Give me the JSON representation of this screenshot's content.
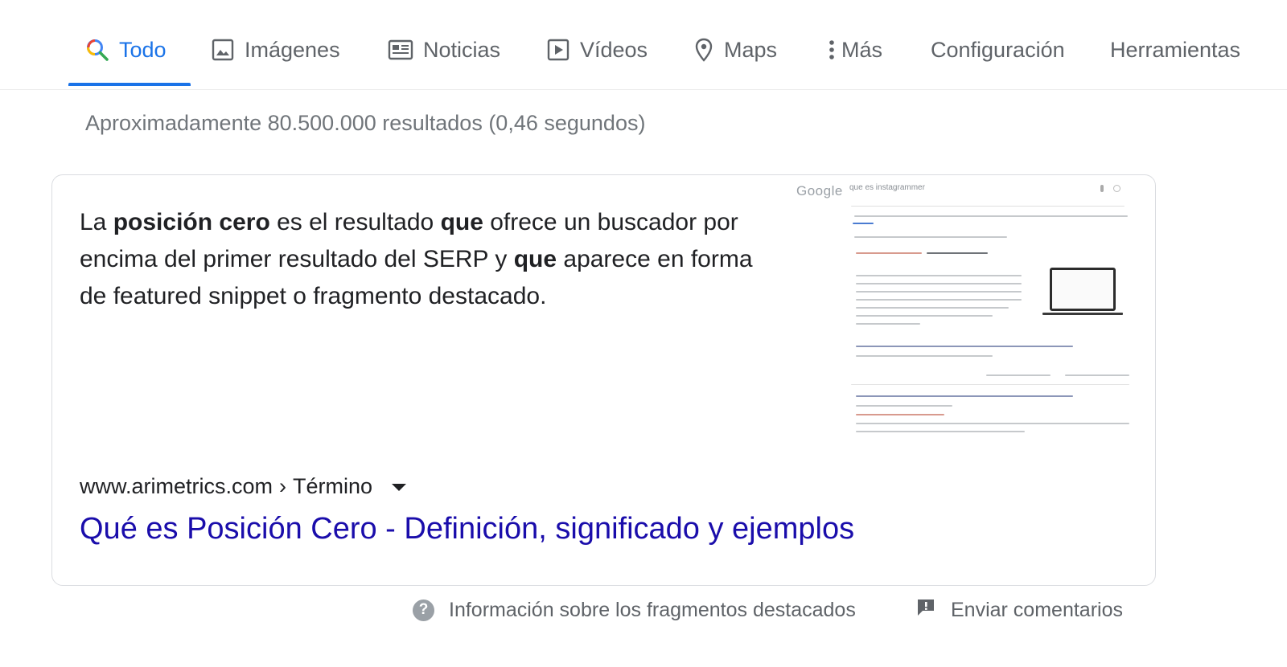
{
  "tabs": [
    {
      "label": "Todo",
      "icon": "search-icon",
      "active": true
    },
    {
      "label": "Imágenes",
      "icon": "image-icon",
      "active": false
    },
    {
      "label": "Noticias",
      "icon": "news-icon",
      "active": false
    },
    {
      "label": "Vídeos",
      "icon": "video-play-icon",
      "active": false
    },
    {
      "label": "Maps",
      "icon": "map-pin-icon",
      "active": false
    },
    {
      "label": "Más",
      "icon": "more-vert-icon",
      "active": false
    },
    {
      "label": "Configuración",
      "active": false
    },
    {
      "label": "Herramientas",
      "active": false
    }
  ],
  "result_stats": "Aproximadamente 80.500.000 resultados (0,46 segundos)",
  "snippet": {
    "parts": [
      {
        "text": "La ",
        "bold": false
      },
      {
        "text": "posición cero",
        "bold": true
      },
      {
        "text": " es el resultado ",
        "bold": false
      },
      {
        "text": "que",
        "bold": true
      },
      {
        "text": " ofrece un buscador por encima del primer resultado del SERP y ",
        "bold": false
      },
      {
        "text": "que",
        "bold": true
      },
      {
        "text": " aparece en forma de featured snippet o fragmento destacado.",
        "bold": false
      }
    ],
    "thumbnail": {
      "logo_text": "Google",
      "search_text": "que es instagrammer"
    },
    "breadcrumb": {
      "domain": "www.arimetrics.com",
      "separator": "›",
      "path": "Término"
    },
    "title": "Qué es Posición Cero - Definición, significado y ejemplos"
  },
  "footer": {
    "about_label": "Información sobre los fragmentos destacados",
    "feedback_label": "Enviar comentarios"
  },
  "colors": {
    "accent": "#1a73e8",
    "link": "#1a0dab",
    "muted_text": "#5f6368",
    "stats_text": "#70757a"
  }
}
